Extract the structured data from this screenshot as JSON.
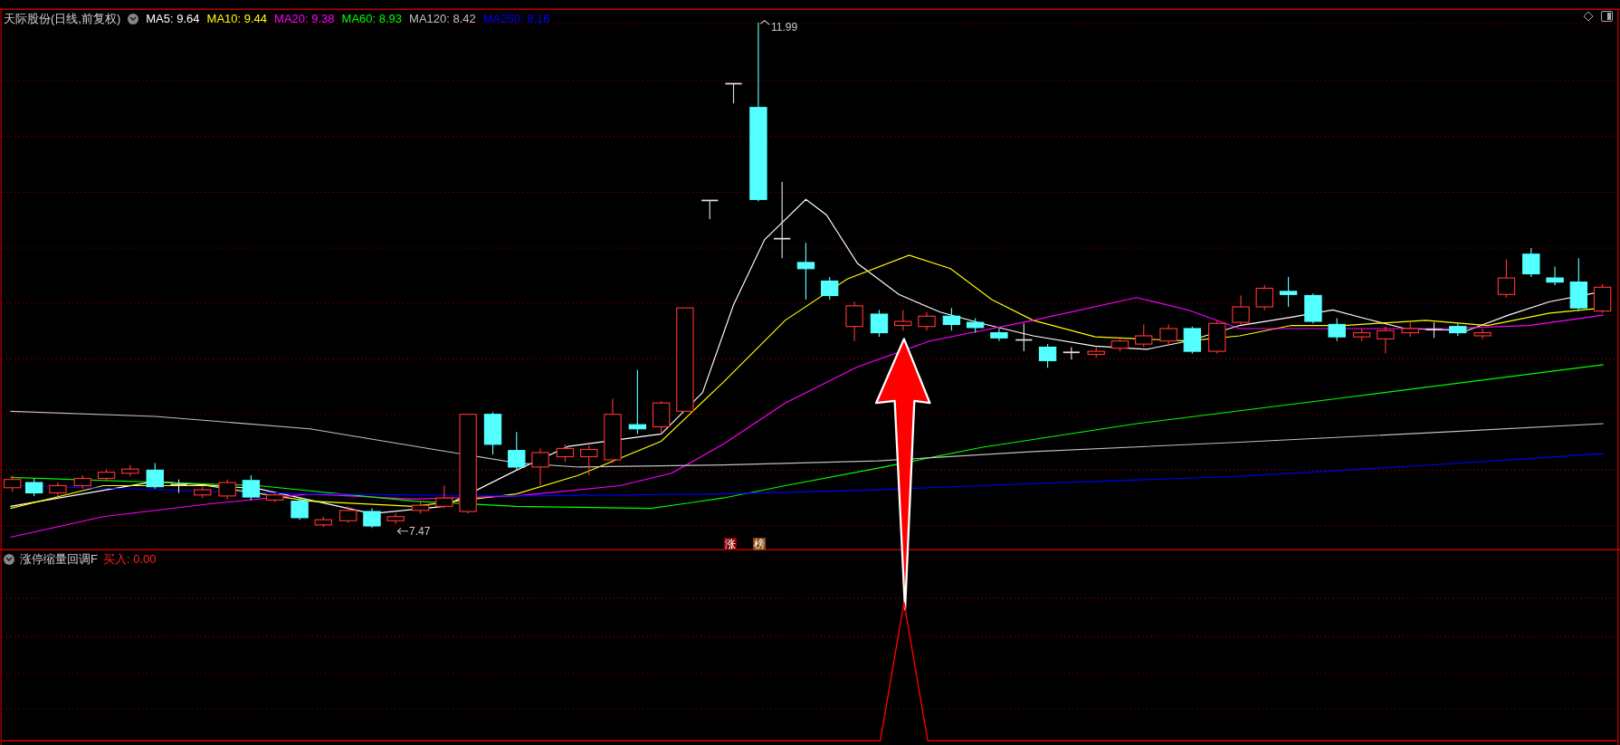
{
  "main_chart": {
    "title": "天际股份(日线,前复权)",
    "moving_averages": [
      {
        "label": "MA5: 9.64",
        "color": "#ffffff"
      },
      {
        "label": "MA10: 9.44",
        "color": "#ffff00"
      },
      {
        "label": "MA20: 9.38",
        "color": "#ff00ff"
      },
      {
        "label": "MA60: 8.93",
        "color": "#00ff00"
      },
      {
        "label": "MA120: 8.42",
        "color": "#c0c0c0"
      },
      {
        "label": "MA250: 8.16",
        "color": "#0000ff"
      }
    ],
    "high_label": "11.99",
    "low_label": "7.47",
    "markers": [
      {
        "text": "涨",
        "color": "#8b0000"
      },
      {
        "text": "榜",
        "color": "#8b4513"
      }
    ]
  },
  "indicator_panel": {
    "title": "涨停缩量回调F",
    "signal_label": "买入: 0.00"
  }
}
